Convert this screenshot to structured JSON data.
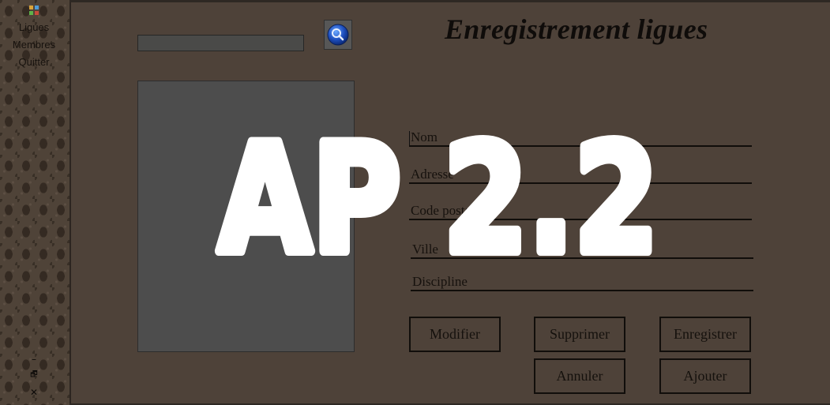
{
  "sidebar": {
    "app_icon": "app-icon",
    "items": [
      {
        "name": "nav-ligues",
        "label": "Ligues"
      },
      {
        "name": "nav-membres",
        "label": "Membres"
      },
      {
        "name": "nav-quitter",
        "label": "Quitter"
      }
    ],
    "window_controls": {
      "minimize": "–",
      "restore": "🗗",
      "close": "✕"
    }
  },
  "header": {
    "title": "Enregistrement ligues"
  },
  "search": {
    "value": "",
    "placeholder": "",
    "icon": "search-icon"
  },
  "form": {
    "fields": [
      {
        "label": "Nom"
      },
      {
        "label": "Adresse"
      },
      {
        "label": "Code postal"
      },
      {
        "label": "Ville"
      },
      {
        "label": "Discipline"
      }
    ]
  },
  "buttons": {
    "modifier": "Modifier",
    "supprimer": "Supprimer",
    "enregistrer": "Enregistrer",
    "annuler": "Annuler",
    "ajouter": "Ajouter"
  },
  "overlay": {
    "text": "AP 2.2",
    "color": "#ffffff"
  },
  "colors": {
    "background": "#4e4239",
    "text": "#16110d"
  }
}
